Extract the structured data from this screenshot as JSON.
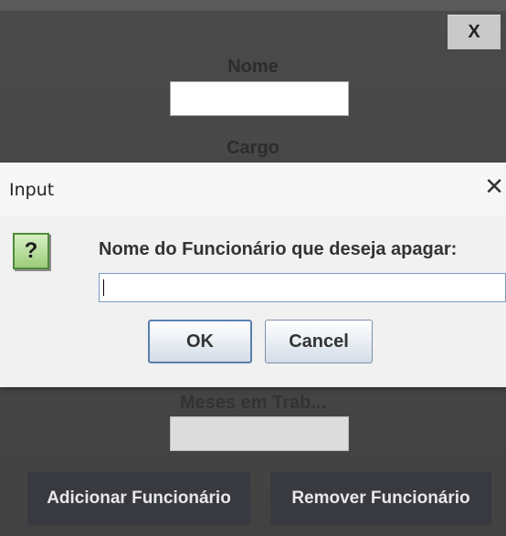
{
  "main_window": {
    "close_label": "X",
    "fields": [
      {
        "label": "Nome"
      },
      {
        "label": "Cargo"
      },
      {
        "label": "Meses em Trab..."
      }
    ],
    "buttons": {
      "add_label": "Adicionar Funcionário",
      "remove_label": "Remover Funcionário"
    }
  },
  "dialog": {
    "title": "Input",
    "close_glyph": "✕",
    "icon_glyph": "?",
    "icon_name": "question-icon",
    "prompt": "Nome do Funcionário que deseja apagar:",
    "input_value": "",
    "ok_label": "OK",
    "cancel_label": "Cancel"
  }
}
